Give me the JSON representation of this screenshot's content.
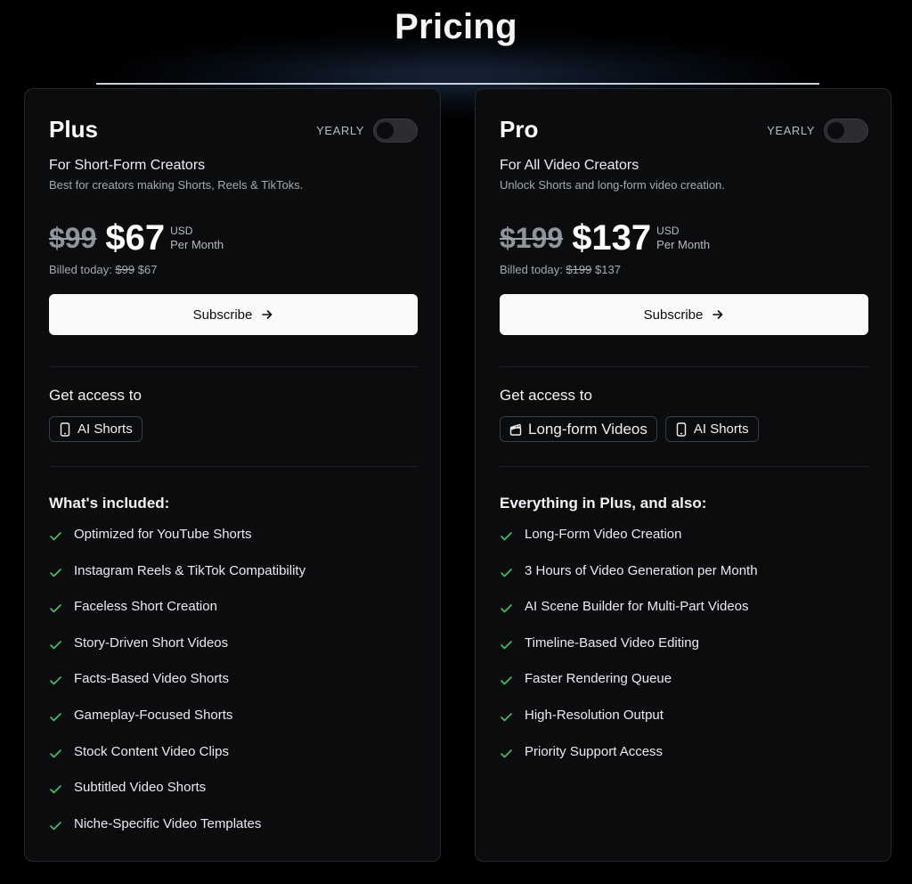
{
  "page": {
    "title": "Pricing"
  },
  "colors": {
    "check": "#3fbf6a",
    "button_bg": "#fafafa",
    "card_bg": "#0b0c0e"
  },
  "plans": [
    {
      "name": "Plus",
      "billing_label": "YEARLY",
      "subtitle": "For Short-Form Creators",
      "description": "Best for creators making Shorts, Reels & TikToks.",
      "old_price": "$99",
      "new_price": "$67",
      "currency": "USD",
      "period": "Per Month",
      "billed_label": "Billed today:",
      "billed_old": "$99",
      "billed_new": "$67",
      "cta": "Subscribe",
      "access_title": "Get access to",
      "access": [
        {
          "label": "AI Shorts",
          "icon": "phone-icon"
        }
      ],
      "features_title": "What's included:",
      "features": [
        "Optimized for YouTube Shorts",
        "Instagram Reels & TikTok Compatibility",
        "Faceless Short Creation",
        "Story-Driven Short Videos",
        "Facts-Based Video Shorts",
        "Gameplay-Focused Shorts",
        "Stock Content Video Clips",
        "Subtitled Video Shorts",
        "Niche-Specific Video Templates"
      ]
    },
    {
      "name": "Pro",
      "billing_label": "YEARLY",
      "subtitle": "For All Video Creators",
      "description": "Unlock Shorts and long-form video creation.",
      "old_price": "$199",
      "new_price": "$137",
      "currency": "USD",
      "period": "Per Month",
      "billed_label": "Billed today:",
      "billed_old": "$199",
      "billed_new": "$137",
      "cta": "Subscribe",
      "access_title": "Get access to",
      "access": [
        {
          "label": "Long-form Videos",
          "icon": "clapperboard-icon"
        },
        {
          "label": "AI Shorts",
          "icon": "phone-icon"
        }
      ],
      "features_title": "Everything in Plus, and also:",
      "features": [
        "Long-Form Video Creation",
        "3 Hours of Video Generation per Month",
        "AI Scene Builder for Multi-Part Videos",
        "Timeline-Based Video Editing",
        "Faster Rendering Queue",
        "High-Resolution Output",
        "Priority Support Access"
      ]
    }
  ]
}
